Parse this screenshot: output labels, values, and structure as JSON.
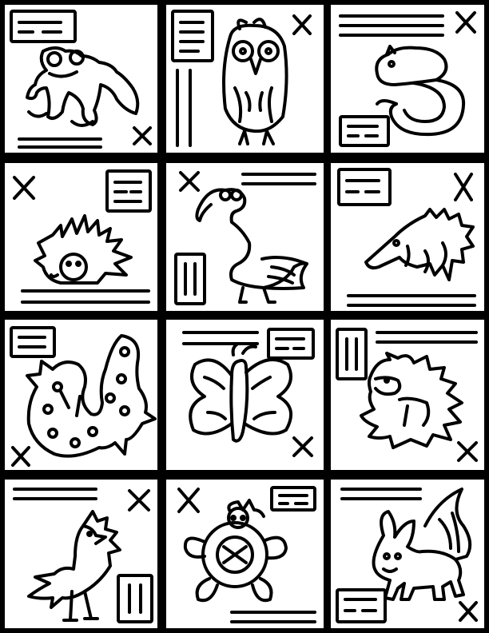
{
  "sheet": {
    "style": "black-and-white line-art animal card grid",
    "rows": 4,
    "columns": 3,
    "colors": {
      "ink": "#000000",
      "paper": "#ffffff"
    }
  },
  "cells": [
    {
      "animal": "frog",
      "marks": [
        "label-box",
        "lines",
        "cross-icon"
      ]
    },
    {
      "animal": "owl",
      "marks": [
        "label-box",
        "lines",
        "cross-icon"
      ]
    },
    {
      "animal": "snake",
      "marks": [
        "label-box",
        "lines",
        "cross-icon"
      ]
    },
    {
      "animal": "hedgehog",
      "marks": [
        "label-box",
        "lines",
        "cross-icon"
      ]
    },
    {
      "animal": "flamingo",
      "marks": [
        "label-box",
        "lines",
        "cross-icon"
      ]
    },
    {
      "animal": "opossum",
      "marks": [
        "label-box",
        "lines",
        "cross-icon"
      ]
    },
    {
      "animal": "salamander",
      "marks": [
        "label-box",
        "cross-icon"
      ]
    },
    {
      "animal": "butterfly",
      "marks": [
        "label-box",
        "lines",
        "cross-icon"
      ]
    },
    {
      "animal": "lion",
      "marks": [
        "label-box",
        "lines",
        "cross-icon"
      ]
    },
    {
      "animal": "bird",
      "marks": [
        "label-box",
        "lines",
        "cross-icon"
      ]
    },
    {
      "animal": "turtle",
      "marks": [
        "label-box",
        "lines",
        "cross-icon"
      ]
    },
    {
      "animal": "fox",
      "marks": [
        "label-box",
        "lines",
        "cross-icon"
      ]
    }
  ]
}
